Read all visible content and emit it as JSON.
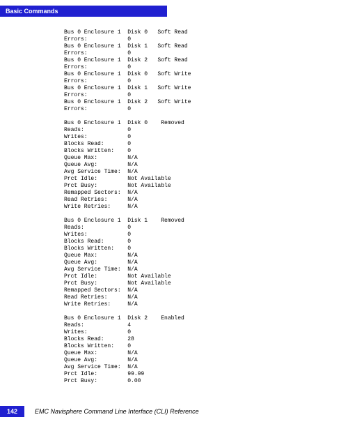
{
  "header": {
    "title": "Basic Commands"
  },
  "footer": {
    "page": "142",
    "text": "EMC Navisphere Command Line Interface (CLI) Reference"
  },
  "errors_section": [
    {
      "header": "Bus 0 Enclosure 1  Disk 0   Soft Read",
      "label": "Errors:",
      "value": "0"
    },
    {
      "header": "Bus 0 Enclosure 1  Disk 1   Soft Read",
      "label": "Errors:",
      "value": "0"
    },
    {
      "header": "Bus 0 Enclosure 1  Disk 2   Soft Read",
      "label": "Errors:",
      "value": "0"
    },
    {
      "header": "Bus 0 Enclosure 1  Disk 0   Soft Write",
      "label": "Errors:",
      "value": "0"
    },
    {
      "header": "Bus 0 Enclosure 1  Disk 1   Soft Write",
      "label": "Errors:",
      "value": "0"
    },
    {
      "header": "Bus 0 Enclosure 1  Disk 2   Soft Write",
      "label": "Errors:",
      "value": "0"
    }
  ],
  "disks": [
    {
      "title": "Bus 0 Enclosure 1  Disk 0    Removed",
      "metrics": [
        {
          "label": "Reads:",
          "value": "0"
        },
        {
          "label": "Writes:",
          "value": "0"
        },
        {
          "label": "Blocks Read:",
          "value": "0"
        },
        {
          "label": "Blocks Written:",
          "value": "0"
        },
        {
          "label": "Queue Max:",
          "value": "N/A"
        },
        {
          "label": "Queue Avg:",
          "value": "N/A"
        },
        {
          "label": "Avg Service Time:",
          "value": "N/A"
        },
        {
          "label": "Prct Idle:",
          "value": "Not Available"
        },
        {
          "label": "Prct Busy:",
          "value": "Not Available"
        },
        {
          "label": "Remapped Sectors:",
          "value": "N/A"
        },
        {
          "label": "Read Retries:",
          "value": "N/A"
        },
        {
          "label": "Write Retries:",
          "value": "N/A"
        }
      ]
    },
    {
      "title": "Bus 0 Enclosure 1  Disk 1    Removed",
      "metrics": [
        {
          "label": "Reads:",
          "value": "0"
        },
        {
          "label": "Writes:",
          "value": "0"
        },
        {
          "label": "Blocks Read:",
          "value": "0"
        },
        {
          "label": "Blocks Written:",
          "value": "0"
        },
        {
          "label": "Queue Max:",
          "value": "N/A"
        },
        {
          "label": "Queue Avg:",
          "value": "N/A"
        },
        {
          "label": "Avg Service Time:",
          "value": "N/A"
        },
        {
          "label": "Prct Idle:",
          "value": "Not Available"
        },
        {
          "label": "Prct Busy:",
          "value": "Not Available"
        },
        {
          "label": "Remapped Sectors:",
          "value": "N/A"
        },
        {
          "label": "Read Retries:",
          "value": "N/A"
        },
        {
          "label": "Write Retries:",
          "value": "N/A"
        }
      ]
    },
    {
      "title": "Bus 0 Enclosure 1  Disk 2    Enabled",
      "metrics": [
        {
          "label": "Reads:",
          "value": "4"
        },
        {
          "label": "Writes:",
          "value": "0"
        },
        {
          "label": "Blocks Read:",
          "value": "28"
        },
        {
          "label": "Blocks Written:",
          "value": "0"
        },
        {
          "label": "Queue Max:",
          "value": "N/A"
        },
        {
          "label": "Queue Avg:",
          "value": "N/A"
        },
        {
          "label": "Avg Service Time:",
          "value": "N/A"
        },
        {
          "label": "Prct Idle:",
          "value": "99.99"
        },
        {
          "label": "Prct Busy:",
          "value": "0.00"
        }
      ]
    }
  ]
}
